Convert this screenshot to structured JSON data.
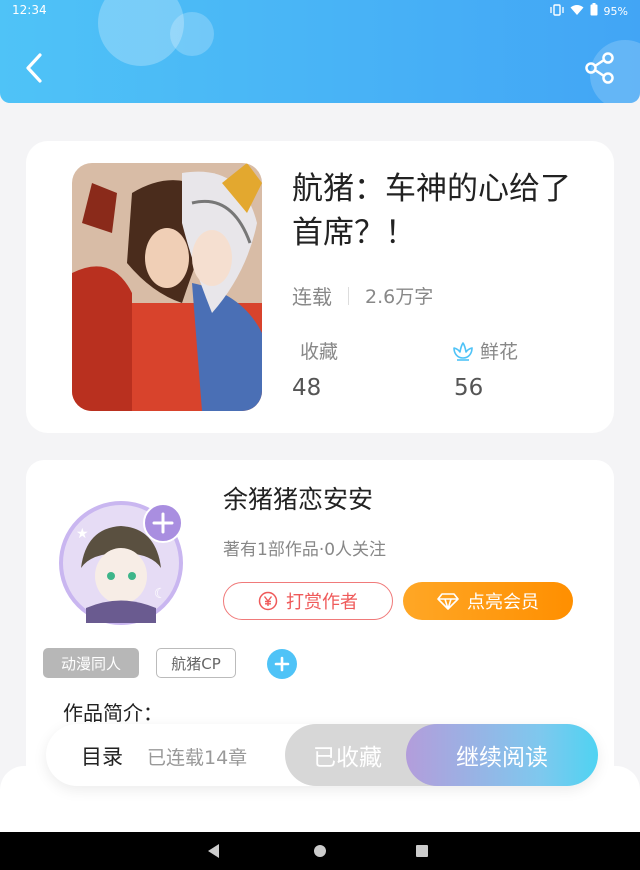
{
  "status_bar": {
    "time": "12:34",
    "battery": "95%"
  },
  "book": {
    "title": "航猪：车神的心给了首席？！",
    "status": "连载",
    "word_count": "2.6万字",
    "favorites_label": "收藏",
    "favorites_count": "48",
    "flowers_label": "鲜花",
    "flowers_count": "56"
  },
  "author": {
    "name": "余猪猪恋安安",
    "summary": "著有1部作品·0人关注",
    "tip_button": "打赏作者",
    "vip_button": "点亮会员"
  },
  "tags": [
    "动漫同人",
    "航猪CP"
  ],
  "intro_label": "作品简介：",
  "bottom_bar": {
    "toc_label": "目录",
    "chapter_count": "已连载14章",
    "favorited_button": "已收藏",
    "continue_button": "继续阅读"
  },
  "colors": {
    "header": "#4fc3f7",
    "accent": "#4fc3f7",
    "tip": "#ef5a5a",
    "vip": "#ff9800"
  }
}
